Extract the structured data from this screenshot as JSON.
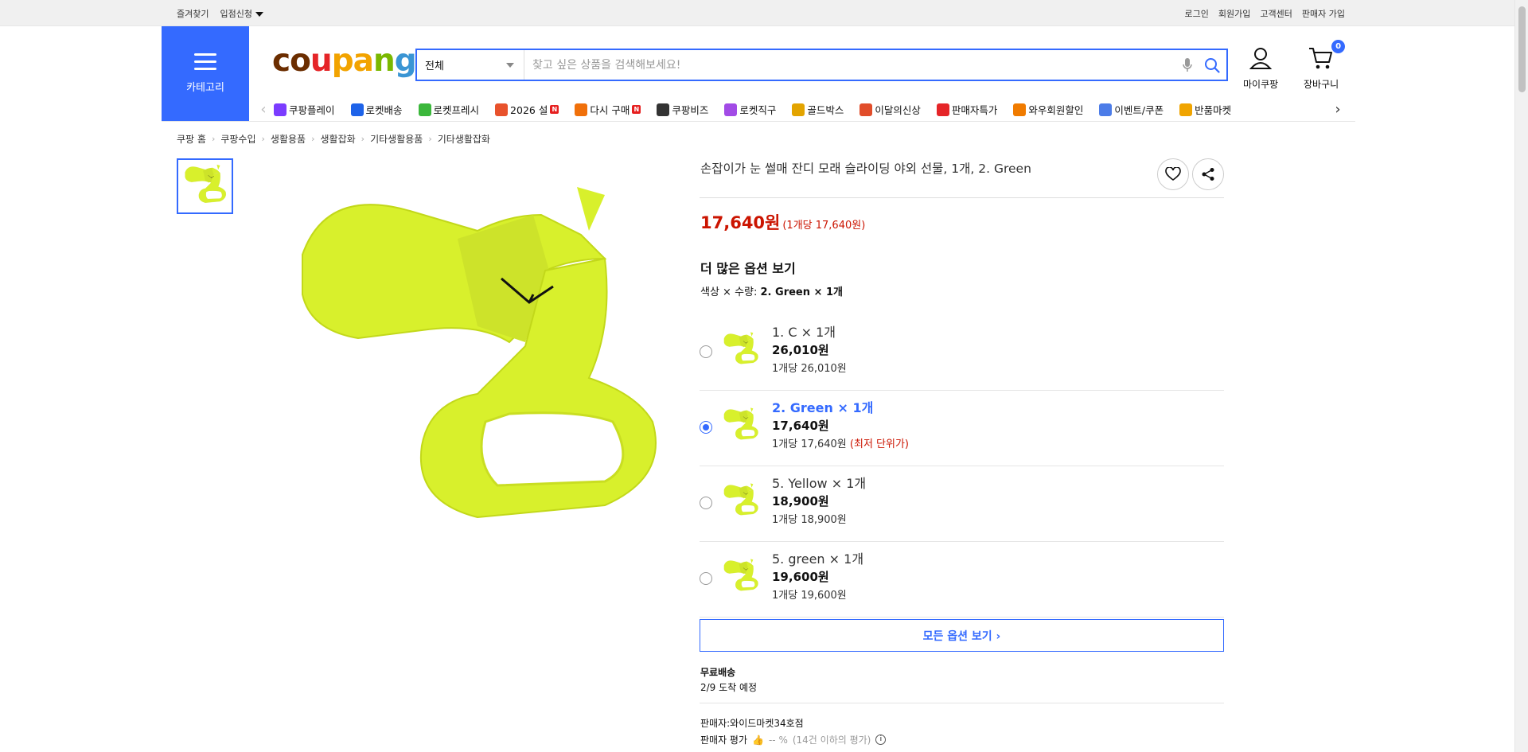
{
  "topbar": {
    "bookmark": "즐겨찾기",
    "apply": "입점신청",
    "login": "로그인",
    "signup": "회원가입",
    "support": "고객센터",
    "seller_signup": "판매자 가입"
  },
  "header": {
    "category_label": "카테고리",
    "logo": "coupang",
    "logo_colors": [
      "#6b2d00",
      "#e52528",
      "#f2a300",
      "#7ab800",
      "#3a95d4"
    ],
    "search_scope": "전체",
    "search_placeholder": "찾고 싶은 상품을 검색해보세요!",
    "mypage_label": "마이쿠팡",
    "cart_label": "장바구니",
    "cart_count": "0",
    "accent_color": "#346aff"
  },
  "menu": [
    {
      "label": "쿠팡플레이",
      "icon": "play-icon",
      "badge": ""
    },
    {
      "label": "로켓배송",
      "icon": "rocket-icon",
      "badge": ""
    },
    {
      "label": "로켓프레시",
      "icon": "rocket-fresh-icon",
      "badge": ""
    },
    {
      "label": "2026 설",
      "icon": "gift-icon",
      "badge": "N"
    },
    {
      "label": "다시 구매",
      "icon": "house-icon",
      "badge": "N"
    },
    {
      "label": "쿠팡비즈",
      "icon": "biz-icon",
      "badge": ""
    },
    {
      "label": "로켓직구",
      "icon": "global-icon",
      "badge": ""
    },
    {
      "label": "골드박스",
      "icon": "goldbox-icon",
      "badge": ""
    },
    {
      "label": "이달의신상",
      "icon": "new-icon",
      "badge": ""
    },
    {
      "label": "판매자특가",
      "icon": "percent-icon",
      "badge": ""
    },
    {
      "label": "와우회원할인",
      "icon": "wow-icon",
      "badge": ""
    },
    {
      "label": "이벤트/쿠폰",
      "icon": "coupon-icon",
      "badge": ""
    },
    {
      "label": "반품마켓",
      "icon": "return-market-icon",
      "badge": ""
    }
  ],
  "breadcrumb": [
    "쿠팡 홈",
    "쿠팡수입",
    "생활용품",
    "생활잡화",
    "기타생활용품",
    "기타생활잡화"
  ],
  "product": {
    "title": "손잡이가 눈 썰매 잔디 모래 슬라이딩 야외 선물, 1개, 2. Green",
    "price": "17,640원",
    "unit_price": "(1개당 17,640원)",
    "more_options": "더 많은 옵션 보기",
    "option_caption": "색상 × 수량: ",
    "option_selected": "2. Green × 1개",
    "product_color": "#d8f02c",
    "options": [
      {
        "name": "1. C × 1개",
        "price": "26,010원",
        "unit": "1개당 26,010원",
        "lowest": "",
        "selected": false
      },
      {
        "name": "2. Green × 1개",
        "price": "17,640원",
        "unit": "1개당 17,640원",
        "lowest": "(최저 단위가)",
        "selected": true
      },
      {
        "name": "5. Yellow × 1개",
        "price": "18,900원",
        "unit": "1개당 18,900원",
        "lowest": "",
        "selected": false
      },
      {
        "name": "5. green × 1개",
        "price": "19,600원",
        "unit": "1개당 19,600원",
        "lowest": "",
        "selected": false
      }
    ],
    "all_options": "모든 옵션 보기 ›",
    "shipping_title": "무료배송",
    "shipping_date": "2/9 도착 예정",
    "seller": "판매자:와이드마켓34호점",
    "seller_rating_label": "판매자 평가",
    "seller_rating": "-- %",
    "seller_rating_note": "(14건 이하의 평가)"
  }
}
